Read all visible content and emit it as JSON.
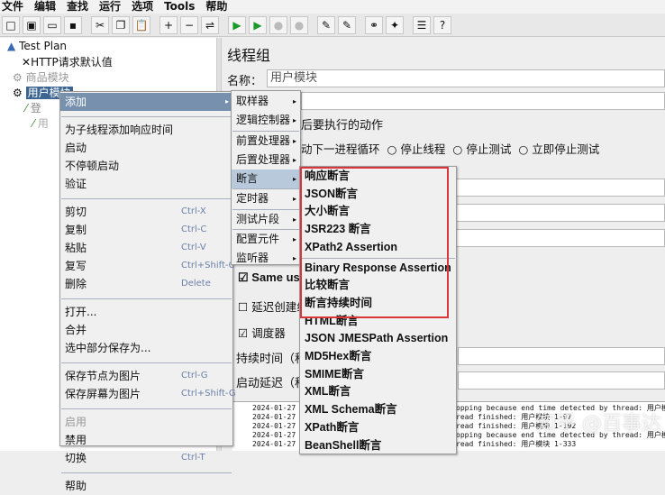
{
  "menubar": [
    "文件",
    "编辑",
    "查找",
    "运行",
    "选项",
    "Tools",
    "帮助"
  ],
  "toolbar": [
    {
      "icon": "new-icon",
      "g": "□"
    },
    {
      "icon": "templates-icon",
      "g": "▣"
    },
    {
      "icon": "open-icon",
      "g": "▭"
    },
    {
      "icon": "save-icon",
      "g": "▪"
    },
    {
      "icon": "cut-icon",
      "g": "✂"
    },
    {
      "icon": "copy-icon",
      "g": "❐"
    },
    {
      "icon": "paste-icon",
      "g": "📋"
    },
    {
      "icon": "expand-icon",
      "g": "+"
    },
    {
      "icon": "collapse-icon",
      "g": "−"
    },
    {
      "icon": "toggle-icon",
      "g": "⇌"
    },
    {
      "icon": "start-icon",
      "g": "▶"
    },
    {
      "icon": "start-no-pause-icon",
      "g": "▶"
    },
    {
      "icon": "stop-icon",
      "g": "●"
    },
    {
      "icon": "shutdown-icon",
      "g": "●"
    },
    {
      "icon": "clear-icon",
      "g": "✎"
    },
    {
      "icon": "clear-all-icon",
      "g": "✎"
    },
    {
      "icon": "search-icon",
      "g": "⚭"
    },
    {
      "icon": "reset-search-icon",
      "g": "✦"
    },
    {
      "icon": "function-helper-icon",
      "g": "☰"
    },
    {
      "icon": "help-icon",
      "g": "?"
    }
  ],
  "tree": {
    "test_plan": "Test Plan",
    "http_defaults": "HTTP请求默认值",
    "goods_module": "商品模块",
    "user_module": "用户模块",
    "child1": "登",
    "child2": "用"
  },
  "panel": {
    "title": "线程组",
    "name_label": "名称：",
    "name_value": "用户模块",
    "action_label": "后要执行的动作",
    "action_next": "动下一进程循环",
    "radio_stop_thread": "停止线程",
    "radio_stop_test": "停止测试",
    "radio_stop_now": "立即停止测试",
    "same_user": "Same use",
    "delay_create": "延迟创建线",
    "scheduler": "调度器",
    "duration": "持续时间（秒",
    "startup_delay": "启动延迟（秒"
  },
  "context_menu": [
    {
      "label": "添加",
      "arrow": true,
      "state": "active"
    },
    {
      "sep": true
    },
    {
      "label": "为子线程添加响应时间"
    },
    {
      "label": "启动"
    },
    {
      "label": "不停顿启动"
    },
    {
      "label": "验证"
    },
    {
      "sep": true
    },
    {
      "label": "剪切",
      "shortcut": "Ctrl-X"
    },
    {
      "label": "复制",
      "shortcut": "Ctrl-C"
    },
    {
      "label": "粘贴",
      "shortcut": "Ctrl-V"
    },
    {
      "label": "复写",
      "shortcut": "Ctrl+Shift-C"
    },
    {
      "label": "删除",
      "shortcut": "Delete"
    },
    {
      "sep": true
    },
    {
      "label": "打开..."
    },
    {
      "label": "合并"
    },
    {
      "label": "选中部分保存为..."
    },
    {
      "sep": true
    },
    {
      "label": "保存节点为图片",
      "shortcut": "Ctrl-G"
    },
    {
      "label": "保存屏幕为图片",
      "shortcut": "Ctrl+Shift-G"
    },
    {
      "sep": true
    },
    {
      "label": "启用",
      "state": "disabled"
    },
    {
      "label": "禁用"
    },
    {
      "label": "切换",
      "shortcut": "Ctrl-T"
    },
    {
      "sep": true
    },
    {
      "label": "帮助"
    }
  ],
  "add_submenu": [
    {
      "label": "取样器"
    },
    {
      "label": "逻辑控制器"
    },
    {
      "sep": true
    },
    {
      "label": "前置处理器"
    },
    {
      "label": "后置处理器"
    },
    {
      "label": "断言",
      "state": "active"
    },
    {
      "sep": true
    },
    {
      "label": "定时器"
    },
    {
      "sep": true
    },
    {
      "label": "测试片段"
    },
    {
      "sep": true
    },
    {
      "label": "配置元件"
    },
    {
      "label": "监听器"
    }
  ],
  "assertion_submenu": [
    {
      "label": "响应断言"
    },
    {
      "label": "JSON断言"
    },
    {
      "label": "大小断言"
    },
    {
      "label": "JSR223 断言"
    },
    {
      "label": "XPath2 Assertion"
    },
    {
      "sep": true
    },
    {
      "label": "Binary Response Assertion"
    },
    {
      "label": "比较断言"
    },
    {
      "label": "断言持续时间"
    },
    {
      "label": "HTML断言"
    },
    {
      "label": "JSON JMESPath Assertion"
    },
    {
      "label": "MD5Hex断言"
    },
    {
      "label": "SMIME断言"
    },
    {
      "label": "XML断言"
    },
    {
      "label": "XML Schema断言"
    },
    {
      "label": "XPath断言"
    },
    {
      "label": "BeanShell断言"
    }
  ],
  "log": {
    "left": [
      "2024-01-27 11:",
      "2024-01-27 11:",
      "2024-01-27 11:",
      "2024-01-27 11:",
      "2024-01-27 11:"
    ],
    "right": [
      "opping because end time detected by thread: 用户模块",
      "read finished: 用户模块 1-97",
      "read finished: 用户模块 1-192",
      "opping because end time detected by thread: 用户模块",
      "read finished: 用户模块 1-333"
    ]
  },
  "watermark": "知乎 @百事达",
  "colors": {
    "selection": "#3c6591",
    "highlight_box": "#d9353a",
    "menu_hover": "#b8c9dc"
  }
}
